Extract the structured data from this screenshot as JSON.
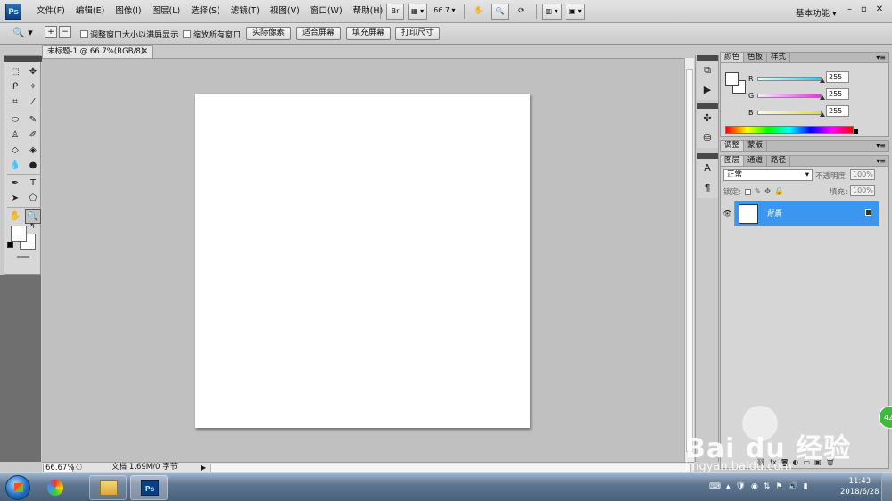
{
  "app": {
    "logo": "Ps",
    "menus": [
      "文件(F)",
      "编辑(E)",
      "图像(I)",
      "图层(L)",
      "选择(S)",
      "滤镜(T)",
      "视图(V)",
      "窗口(W)",
      "帮助(H)"
    ],
    "zoom_value": "66.7",
    "workspace": "基本功能",
    "bridge_label": "Br"
  },
  "options": {
    "check_resize_windows": "调整窗口大小以满屏显示",
    "check_zoom_all": "缩放所有窗口",
    "btn_actual_pixels": "实际像素",
    "btn_fit_screen": "适合屏幕",
    "btn_fill_screen": "填充屏幕",
    "btn_print_size": "打印尺寸"
  },
  "document": {
    "tab_title": "未标题-1 @ 66.7%(RGB/8)",
    "zoom_percent": "66.67%",
    "doc_info": "文档:1.69M/0 字节"
  },
  "color_panel": {
    "tabs": [
      "颜色",
      "色板",
      "样式"
    ],
    "sliders": [
      {
        "label": "R",
        "value": "255",
        "color": "#2ec9d8"
      },
      {
        "label": "G",
        "value": "255",
        "color": "#d83ad8"
      },
      {
        "label": "B",
        "value": "255",
        "color": "#e2e21f"
      }
    ]
  },
  "adjust_panel": {
    "tabs": [
      "调整",
      "蒙版"
    ]
  },
  "layers_panel": {
    "tabs": [
      "图层",
      "通道",
      "路径"
    ],
    "blend_mode": "正常",
    "opacity_label": "不透明度:",
    "opacity_value": "100%",
    "lock_label": "锁定:",
    "fill_label": "填充:",
    "fill_value": "100%",
    "layers": [
      {
        "name": "背景",
        "selected": true
      }
    ],
    "selected_color": "#3d96ee"
  },
  "taskbar": {
    "ps_label": "Ps",
    "time": "11:43",
    "date": "2018/6/28"
  },
  "watermark": {
    "main": "Bai du 经验",
    "sub": "jingyan.baidu.com",
    "badge": "42"
  }
}
